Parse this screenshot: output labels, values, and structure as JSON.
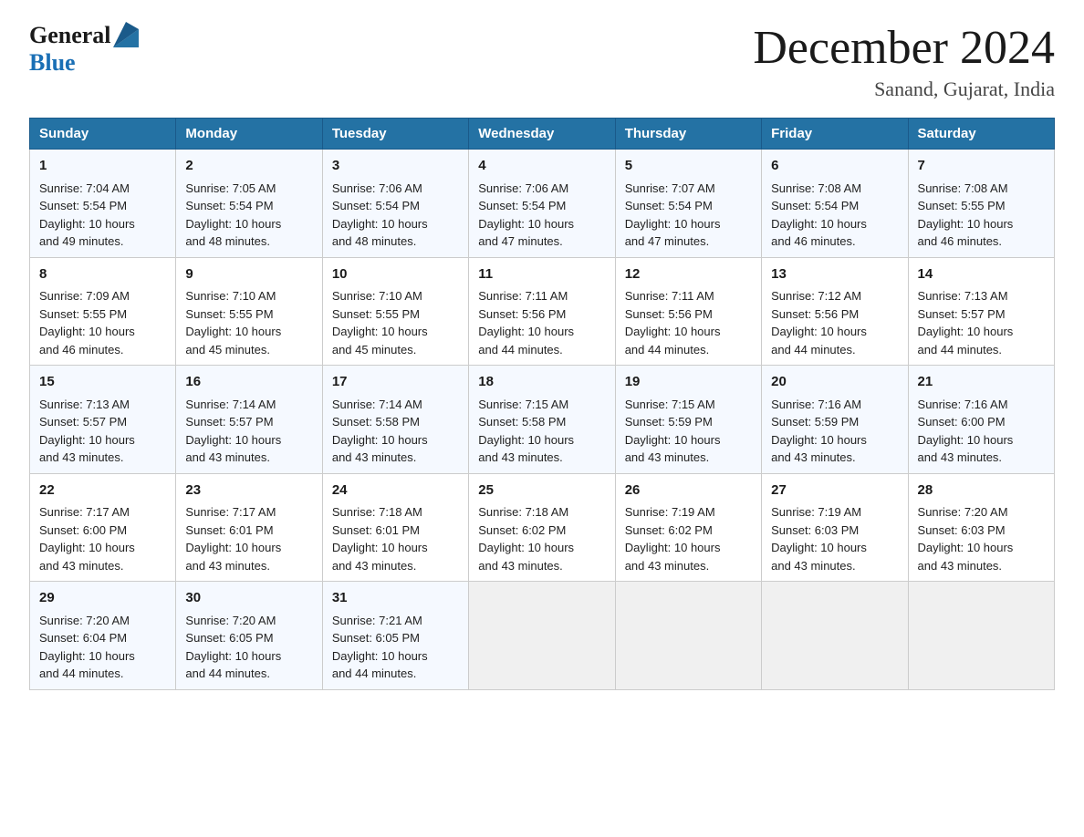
{
  "header": {
    "logo_general": "General",
    "logo_blue": "Blue",
    "month_year": "December 2024",
    "location": "Sanand, Gujarat, India"
  },
  "days_of_week": [
    "Sunday",
    "Monday",
    "Tuesday",
    "Wednesday",
    "Thursday",
    "Friday",
    "Saturday"
  ],
  "weeks": [
    [
      {
        "day": "1",
        "sunrise": "7:04 AM",
        "sunset": "5:54 PM",
        "daylight": "10 hours and 49 minutes."
      },
      {
        "day": "2",
        "sunrise": "7:05 AM",
        "sunset": "5:54 PM",
        "daylight": "10 hours and 48 minutes."
      },
      {
        "day": "3",
        "sunrise": "7:06 AM",
        "sunset": "5:54 PM",
        "daylight": "10 hours and 48 minutes."
      },
      {
        "day": "4",
        "sunrise": "7:06 AM",
        "sunset": "5:54 PM",
        "daylight": "10 hours and 47 minutes."
      },
      {
        "day": "5",
        "sunrise": "7:07 AM",
        "sunset": "5:54 PM",
        "daylight": "10 hours and 47 minutes."
      },
      {
        "day": "6",
        "sunrise": "7:08 AM",
        "sunset": "5:54 PM",
        "daylight": "10 hours and 46 minutes."
      },
      {
        "day": "7",
        "sunrise": "7:08 AM",
        "sunset": "5:55 PM",
        "daylight": "10 hours and 46 minutes."
      }
    ],
    [
      {
        "day": "8",
        "sunrise": "7:09 AM",
        "sunset": "5:55 PM",
        "daylight": "10 hours and 46 minutes."
      },
      {
        "day": "9",
        "sunrise": "7:10 AM",
        "sunset": "5:55 PM",
        "daylight": "10 hours and 45 minutes."
      },
      {
        "day": "10",
        "sunrise": "7:10 AM",
        "sunset": "5:55 PM",
        "daylight": "10 hours and 45 minutes."
      },
      {
        "day": "11",
        "sunrise": "7:11 AM",
        "sunset": "5:56 PM",
        "daylight": "10 hours and 44 minutes."
      },
      {
        "day": "12",
        "sunrise": "7:11 AM",
        "sunset": "5:56 PM",
        "daylight": "10 hours and 44 minutes."
      },
      {
        "day": "13",
        "sunrise": "7:12 AM",
        "sunset": "5:56 PM",
        "daylight": "10 hours and 44 minutes."
      },
      {
        "day": "14",
        "sunrise": "7:13 AM",
        "sunset": "5:57 PM",
        "daylight": "10 hours and 44 minutes."
      }
    ],
    [
      {
        "day": "15",
        "sunrise": "7:13 AM",
        "sunset": "5:57 PM",
        "daylight": "10 hours and 43 minutes."
      },
      {
        "day": "16",
        "sunrise": "7:14 AM",
        "sunset": "5:57 PM",
        "daylight": "10 hours and 43 minutes."
      },
      {
        "day": "17",
        "sunrise": "7:14 AM",
        "sunset": "5:58 PM",
        "daylight": "10 hours and 43 minutes."
      },
      {
        "day": "18",
        "sunrise": "7:15 AM",
        "sunset": "5:58 PM",
        "daylight": "10 hours and 43 minutes."
      },
      {
        "day": "19",
        "sunrise": "7:15 AM",
        "sunset": "5:59 PM",
        "daylight": "10 hours and 43 minutes."
      },
      {
        "day": "20",
        "sunrise": "7:16 AM",
        "sunset": "5:59 PM",
        "daylight": "10 hours and 43 minutes."
      },
      {
        "day": "21",
        "sunrise": "7:16 AM",
        "sunset": "6:00 PM",
        "daylight": "10 hours and 43 minutes."
      }
    ],
    [
      {
        "day": "22",
        "sunrise": "7:17 AM",
        "sunset": "6:00 PM",
        "daylight": "10 hours and 43 minutes."
      },
      {
        "day": "23",
        "sunrise": "7:17 AM",
        "sunset": "6:01 PM",
        "daylight": "10 hours and 43 minutes."
      },
      {
        "day": "24",
        "sunrise": "7:18 AM",
        "sunset": "6:01 PM",
        "daylight": "10 hours and 43 minutes."
      },
      {
        "day": "25",
        "sunrise": "7:18 AM",
        "sunset": "6:02 PM",
        "daylight": "10 hours and 43 minutes."
      },
      {
        "day": "26",
        "sunrise": "7:19 AM",
        "sunset": "6:02 PM",
        "daylight": "10 hours and 43 minutes."
      },
      {
        "day": "27",
        "sunrise": "7:19 AM",
        "sunset": "6:03 PM",
        "daylight": "10 hours and 43 minutes."
      },
      {
        "day": "28",
        "sunrise": "7:20 AM",
        "sunset": "6:03 PM",
        "daylight": "10 hours and 43 minutes."
      }
    ],
    [
      {
        "day": "29",
        "sunrise": "7:20 AM",
        "sunset": "6:04 PM",
        "daylight": "10 hours and 44 minutes."
      },
      {
        "day": "30",
        "sunrise": "7:20 AM",
        "sunset": "6:05 PM",
        "daylight": "10 hours and 44 minutes."
      },
      {
        "day": "31",
        "sunrise": "7:21 AM",
        "sunset": "6:05 PM",
        "daylight": "10 hours and 44 minutes."
      },
      null,
      null,
      null,
      null
    ]
  ],
  "labels": {
    "sunrise": "Sunrise:",
    "sunset": "Sunset:",
    "daylight": "Daylight:"
  }
}
